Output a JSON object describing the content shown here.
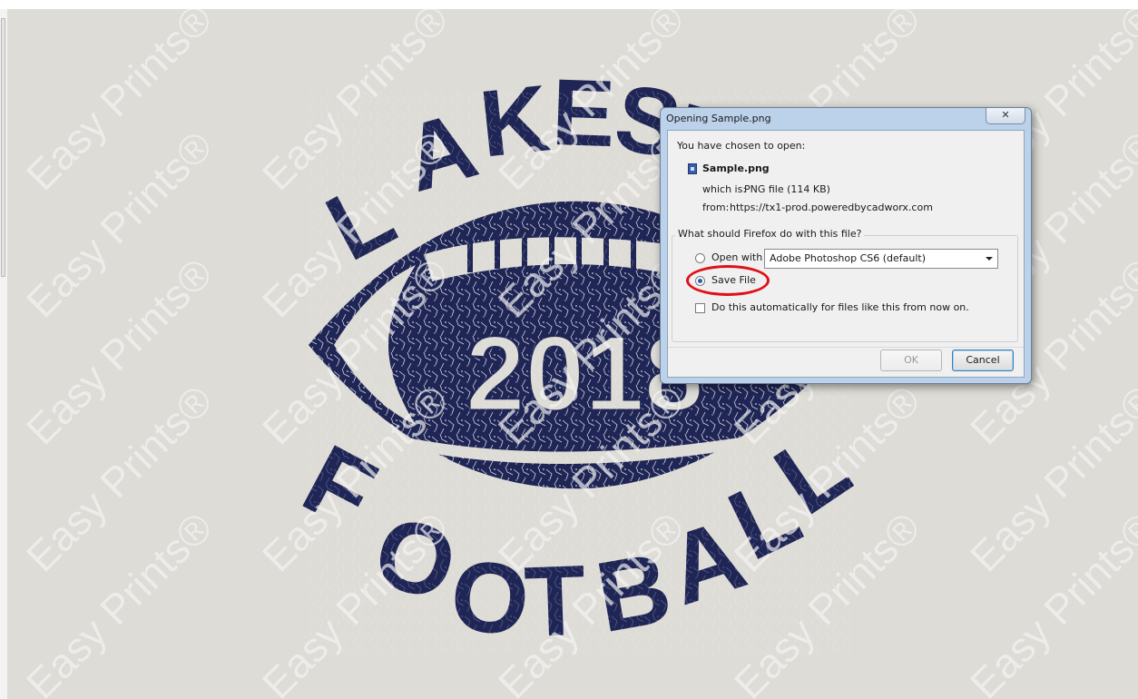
{
  "background": {
    "watermark_text": "Easy Prints®",
    "canvas_color": "#dedcd6",
    "artwork": {
      "top_text": "LAKESIDE",
      "year": "2018",
      "bottom_text": "FOOTBALL",
      "ink_color": "#1f2656"
    }
  },
  "dialog": {
    "title": "Opening Sample.png",
    "close_icon": "close-icon",
    "intro": "You have chosen to open:",
    "file_icon": "png-file-icon",
    "file_name": "Sample.png",
    "which_is_label": "which is:",
    "which_is_value": "PNG file (114 KB)",
    "from_label": "from:",
    "from_value": "https://tx1-prod.poweredbycadworx.com",
    "question": "What should Firefox do with this file?",
    "open_with_label": "Open with",
    "open_with_app": "Adobe Photoshop CS6 (default)",
    "save_file_label": "Save File",
    "selected_option": "Save File",
    "auto_checkbox_label": "Do this automatically for files like this from now on.",
    "auto_checked": false,
    "ok_label": "OK",
    "cancel_label": "Cancel",
    "highlight_color": "#e0101a"
  }
}
